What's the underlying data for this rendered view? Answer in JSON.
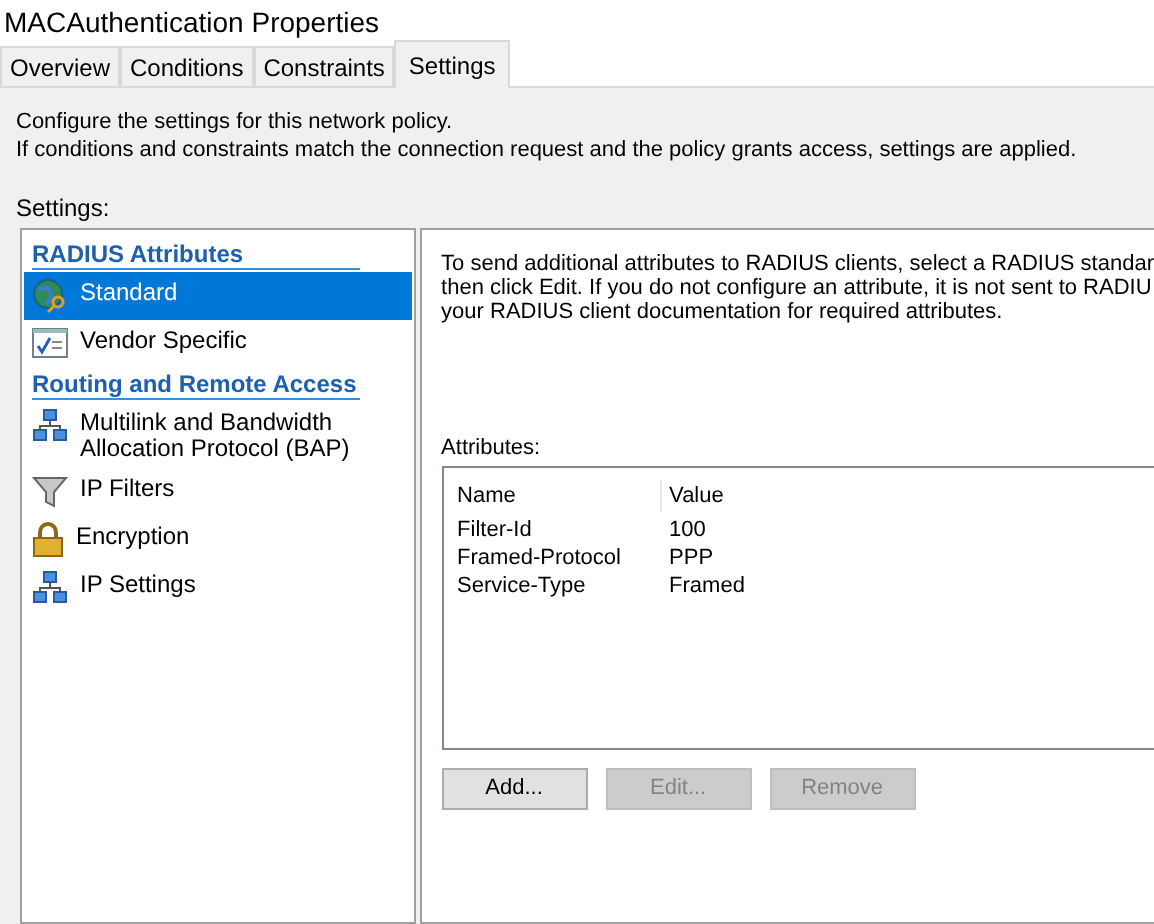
{
  "window": {
    "title": "MACAuthentication Properties"
  },
  "tabs": [
    {
      "label": "Overview",
      "selected": false
    },
    {
      "label": "Conditions",
      "selected": false
    },
    {
      "label": "Constraints",
      "selected": false
    },
    {
      "label": "Settings",
      "selected": true
    }
  ],
  "intro": [
    "Configure the settings for this network policy.",
    "If conditions and constraints match the connection request and the policy grants access, settings are applied."
  ],
  "settings_label": "Settings:",
  "sidebar": {
    "items": [
      {
        "kind": "header",
        "label": "RADIUS Attributes"
      },
      {
        "kind": "item",
        "label": "Standard",
        "selected": true
      },
      {
        "kind": "item",
        "label": "Vendor Specific",
        "selected": false
      },
      {
        "kind": "header",
        "label": "Routing and Remote Access"
      },
      {
        "kind": "item",
        "label": "Multilink and Bandwidth Allocation Protocol (BAP)",
        "selected": false
      },
      {
        "kind": "item",
        "label": "IP Filters",
        "selected": false
      },
      {
        "kind": "item",
        "label": "Encryption",
        "selected": false
      },
      {
        "kind": "item",
        "label": "IP Settings",
        "selected": false
      }
    ]
  },
  "details": {
    "description_lines": [
      "To send additional attributes to RADIUS clients, select a RADIUS standar",
      "then click Edit. If you do not configure an attribute, it is not sent to RADIU",
      "your RADIUS client documentation for required attributes."
    ],
    "attributes_label": "Attributes:",
    "table": {
      "columns": [
        "Name",
        "Value"
      ],
      "rows": [
        [
          "Filter-Id",
          "100"
        ],
        [
          "Framed-Protocol",
          "PPP"
        ],
        [
          "Service-Type",
          "Framed"
        ]
      ]
    },
    "buttons": [
      {
        "label": "Add...",
        "disabled": false
      },
      {
        "label": "Edit...",
        "disabled": true
      },
      {
        "label": "Remove",
        "disabled": true
      }
    ]
  }
}
